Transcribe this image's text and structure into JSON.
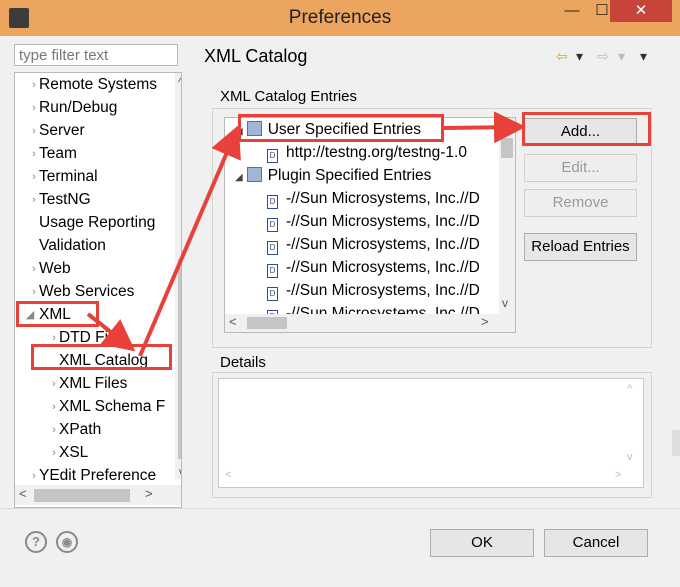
{
  "window": {
    "title": "Preferences",
    "min_glyph": "—",
    "max_glyph": "☐",
    "close_glyph": "✕"
  },
  "filter": {
    "placeholder": "type filter text"
  },
  "tree": {
    "items": [
      {
        "label": "Remote Systems",
        "chevron": "›"
      },
      {
        "label": "Run/Debug",
        "chevron": "›"
      },
      {
        "label": "Server",
        "chevron": "›"
      },
      {
        "label": "Team",
        "chevron": "›"
      },
      {
        "label": "Terminal",
        "chevron": "›"
      },
      {
        "label": "TestNG",
        "chevron": "›"
      },
      {
        "label": "Usage Reporting",
        "chevron": ""
      },
      {
        "label": "Validation",
        "chevron": ""
      },
      {
        "label": "Web",
        "chevron": "›"
      },
      {
        "label": "Web Services",
        "chevron": "›"
      },
      {
        "label": "XML",
        "chevron": "◢"
      },
      {
        "label": "DTD Files",
        "chevron": "›"
      },
      {
        "label": "XML Catalog",
        "chevron": ""
      },
      {
        "label": "XML Files",
        "chevron": "›"
      },
      {
        "label": "XML Schema F",
        "chevron": "›"
      },
      {
        "label": "XPath",
        "chevron": "›"
      },
      {
        "label": "XSL",
        "chevron": "›"
      },
      {
        "label": "YEdit Preference",
        "chevron": "›"
      }
    ],
    "scroll_up": "^",
    "scroll_down": "v",
    "scroll_left": "<",
    "scroll_right": ">"
  },
  "page": {
    "title": "XML Catalog",
    "back_glyph": "⇦",
    "fwd_glyph": "⇨",
    "menu_glyph": "▾"
  },
  "entries": {
    "label": "XML Catalog Entries",
    "items": [
      {
        "text": "User Specified Entries",
        "file": ""
      },
      {
        "text": "http://testng.org/testng-1.0",
        "file": "D"
      },
      {
        "text": "Plugin Specified Entries",
        "file": ""
      },
      {
        "text": "-//Sun Microsystems, Inc.//D",
        "file": "D"
      },
      {
        "text": "-//Sun Microsystems, Inc.//D",
        "file": "D"
      },
      {
        "text": "-//Sun Microsystems, Inc.//D",
        "file": "D"
      },
      {
        "text": "-//Sun Microsystems, Inc.//D",
        "file": "D"
      },
      {
        "text": "-//Sun Microsystems, Inc.//D",
        "file": "D"
      },
      {
        "text": "-//Sun Microsystems, Inc.//D",
        "file": "D"
      }
    ],
    "expand_glyph": "◢"
  },
  "buttons": {
    "add": "Add...",
    "edit": "Edit...",
    "remove": "Remove",
    "reload": "Reload Entries"
  },
  "details": {
    "label": "Details"
  },
  "footer": {
    "help": "?",
    "import": "◉",
    "ok": "OK",
    "cancel": "Cancel"
  },
  "colors": {
    "annotation": "#e8413a",
    "titlebar": "#eba55f",
    "close": "#c7443a"
  }
}
